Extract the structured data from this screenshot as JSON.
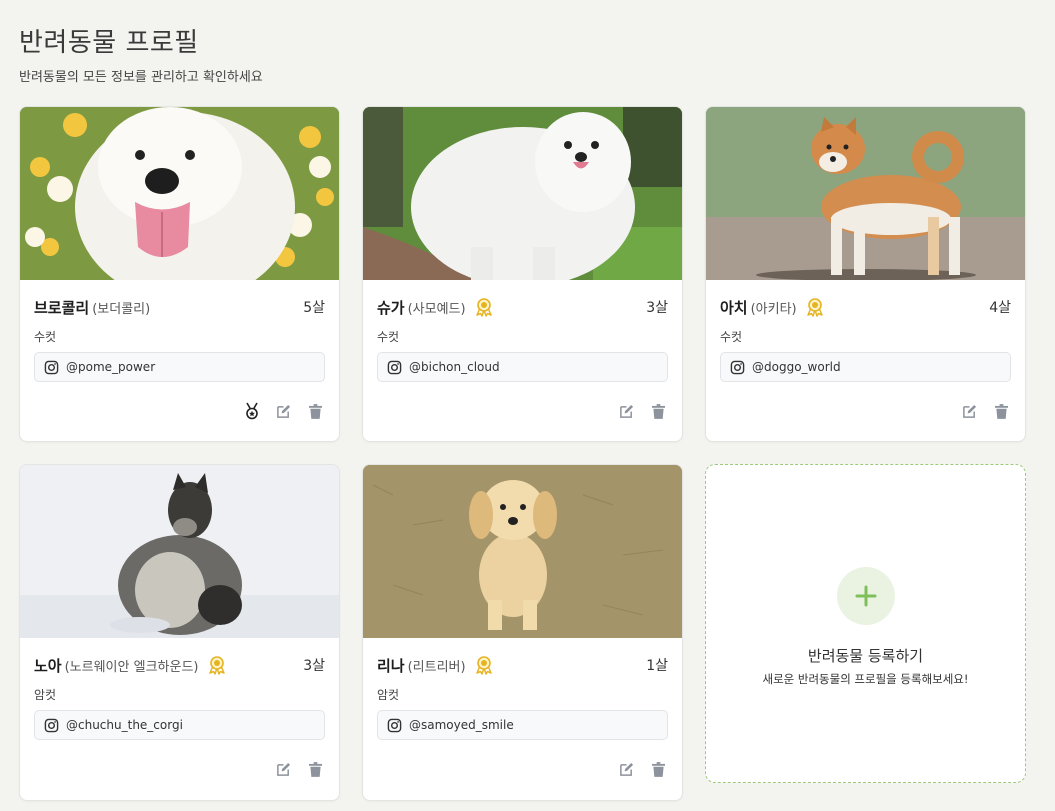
{
  "header": {
    "title": "반려동물 프로필",
    "subtitle": "반려동물의 모든 정보를 관리하고 확인하세요"
  },
  "pets": [
    {
      "name": "브로콜리",
      "breed": "(보더콜리)",
      "age": "5살",
      "sex": "수컷",
      "instagram": "@pome_power",
      "badge": "none",
      "extra_icon": "medal-icon"
    },
    {
      "name": "슈가",
      "breed": "(사모예드)",
      "age": "3살",
      "sex": "수컷",
      "instagram": "@bichon_cloud",
      "badge": "award-ribbon-icon"
    },
    {
      "name": "아치",
      "breed": "(아키타)",
      "age": "4살",
      "sex": "수컷",
      "instagram": "@doggo_world",
      "badge": "award-ribbon-icon"
    },
    {
      "name": "노아",
      "breed": "(노르웨이안 엘크하운드)",
      "age": "3살",
      "sex": "암컷",
      "instagram": "@chuchu_the_corgi",
      "badge": "award-ribbon-icon"
    },
    {
      "name": "리나",
      "breed": "(리트리버)",
      "age": "1살",
      "sex": "암컷",
      "instagram": "@samoyed_smile",
      "badge": "award-ribbon-icon"
    }
  ],
  "add_card": {
    "title": "반려동물 등록하기",
    "description": "새로운 반려동물의 프로필을 등록해보세요!"
  },
  "colors": {
    "background": "#f3f4ef",
    "badge_gold": "#e6b422",
    "accent_green": "#7fbf5a",
    "action_gray": "#8d939c"
  }
}
